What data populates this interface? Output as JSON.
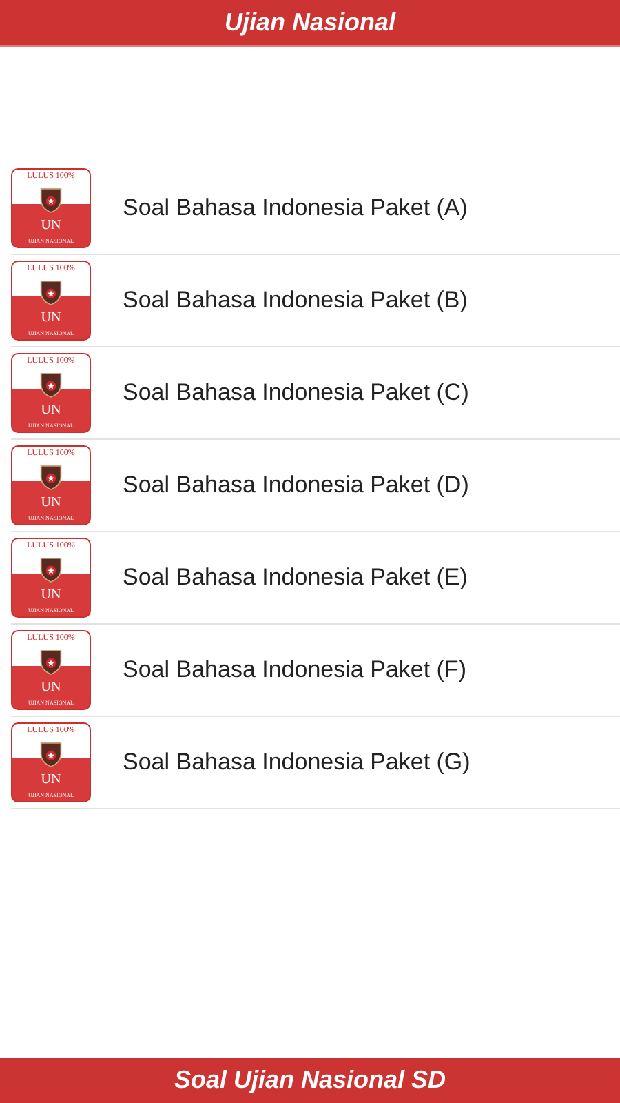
{
  "header": {
    "title": "Ujian Nasional"
  },
  "items": [
    {
      "label": "Soal Bahasa Indonesia Paket (A)",
      "icon": {
        "top": "LULUS 100%",
        "mark": "UN",
        "bottom": "UJIAN NASIONAL"
      }
    },
    {
      "label": "Soal Bahasa Indonesia Paket (B)",
      "icon": {
        "top": "LULUS 100%",
        "mark": "UN",
        "bottom": "UJIAN NASIONAL"
      }
    },
    {
      "label": "Soal Bahasa Indonesia Paket (C)",
      "icon": {
        "top": "LULUS 100%",
        "mark": "UN",
        "bottom": "UJIAN NASIONAL"
      }
    },
    {
      "label": "Soal Bahasa Indonesia Paket (D)",
      "icon": {
        "top": "LULUS 100%",
        "mark": "UN",
        "bottom": "UJIAN NASIONAL"
      }
    },
    {
      "label": "Soal Bahasa Indonesia Paket (E)",
      "icon": {
        "top": "LULUS 100%",
        "mark": "UN",
        "bottom": "UJIAN NASIONAL"
      }
    },
    {
      "label": "Soal Bahasa Indonesia Paket (F)",
      "icon": {
        "top": "LULUS 100%",
        "mark": "UN",
        "bottom": "UJIAN NASIONAL"
      }
    },
    {
      "label": "Soal Bahasa Indonesia Paket (G)",
      "icon": {
        "top": "LULUS 100%",
        "mark": "UN",
        "bottom": "UJIAN NASIONAL"
      }
    }
  ],
  "footer": {
    "title": "Soal Ujian Nasional SD"
  }
}
